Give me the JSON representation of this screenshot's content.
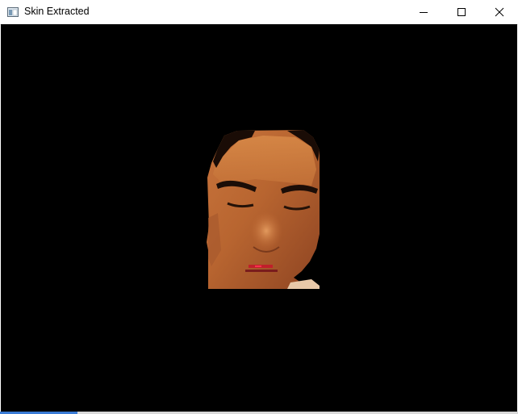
{
  "window": {
    "title": "Skin Extracted",
    "icon": "app-window-icon"
  },
  "controls": {
    "minimize_icon": "minimize-icon",
    "maximize_icon": "maximize-icon",
    "close_icon": "close-icon"
  },
  "image": {
    "description_icon": "skin-extracted-face-image",
    "background_color": "#000000"
  }
}
